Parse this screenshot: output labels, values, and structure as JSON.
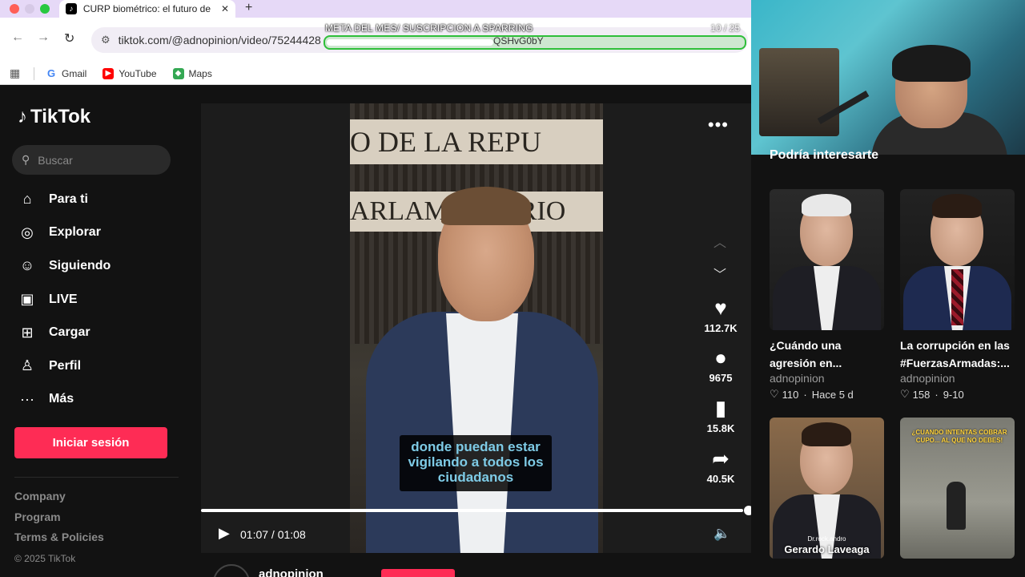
{
  "browser": {
    "tab_title": "CURP biométrico: el futuro de",
    "tab_close": "✕",
    "new_tab": "+",
    "url": "tiktok.com/@adnopinion/video/75244428",
    "bookmarks": [
      {
        "label": "Gmail",
        "icon": "google-icon"
      },
      {
        "label": "YouTube",
        "icon": "youtube-icon"
      },
      {
        "label": "Maps",
        "icon": "maps-icon"
      }
    ]
  },
  "stream_overlay": {
    "goal_text": "META DEL MES/ SUSCRIPCION A SPARRING",
    "goal_count": "10 / 25",
    "goal_fraction": 0.4,
    "inner_text": "QSHvG0bY"
  },
  "tiktok": {
    "logo": "TikTok",
    "search_placeholder": "Buscar",
    "nav": [
      {
        "label": "Para ti",
        "icon": "home-icon",
        "glyph": "⌂"
      },
      {
        "label": "Explorar",
        "icon": "compass-icon",
        "glyph": "◎"
      },
      {
        "label": "Siguiendo",
        "icon": "following-icon",
        "glyph": "☺"
      },
      {
        "label": "LIVE",
        "icon": "live-icon",
        "glyph": "▣"
      },
      {
        "label": "Cargar",
        "icon": "upload-icon",
        "glyph": "⊞"
      },
      {
        "label": "Perfil",
        "icon": "profile-icon",
        "glyph": "♙"
      },
      {
        "label": "Más",
        "icon": "more-icon",
        "glyph": "···"
      }
    ],
    "login_label": "Iniciar sesión",
    "footer": [
      "Company",
      "Program",
      "Terms & Policies"
    ],
    "copyright": "© 2025 TikTok"
  },
  "video": {
    "subtitle": "donde puedan estar vigilando a todos los ciudadanos",
    "banner_top": "O DE LA REPU",
    "banner_bottom": "ARLAMENTARIO",
    "likes": "112.7K",
    "comments": "9675",
    "saves": "15.8K",
    "shares": "40.5K",
    "time": "01:07 / 01:08",
    "progress_fraction": 0.985,
    "author": "adnopinion"
  },
  "suggestions": {
    "title": "Podría interesarte",
    "cards": [
      {
        "title": "¿Cuándo una agresión en...",
        "author": "adnopinion",
        "likes": "110",
        "date": "Hace 5 d"
      },
      {
        "title": "La corrupción en las #FuerzasArmadas:...",
        "author": "adnopinion",
        "likes": "158",
        "date": "9-10"
      },
      {
        "caption": "Gerardo Laveaga",
        "caption_small": "Dr.rock.andro"
      },
      {
        "overlay_text": "¿CUANDO INTENTAS COBRAR CUPO... AL QUE NO DEBES!"
      }
    ]
  }
}
